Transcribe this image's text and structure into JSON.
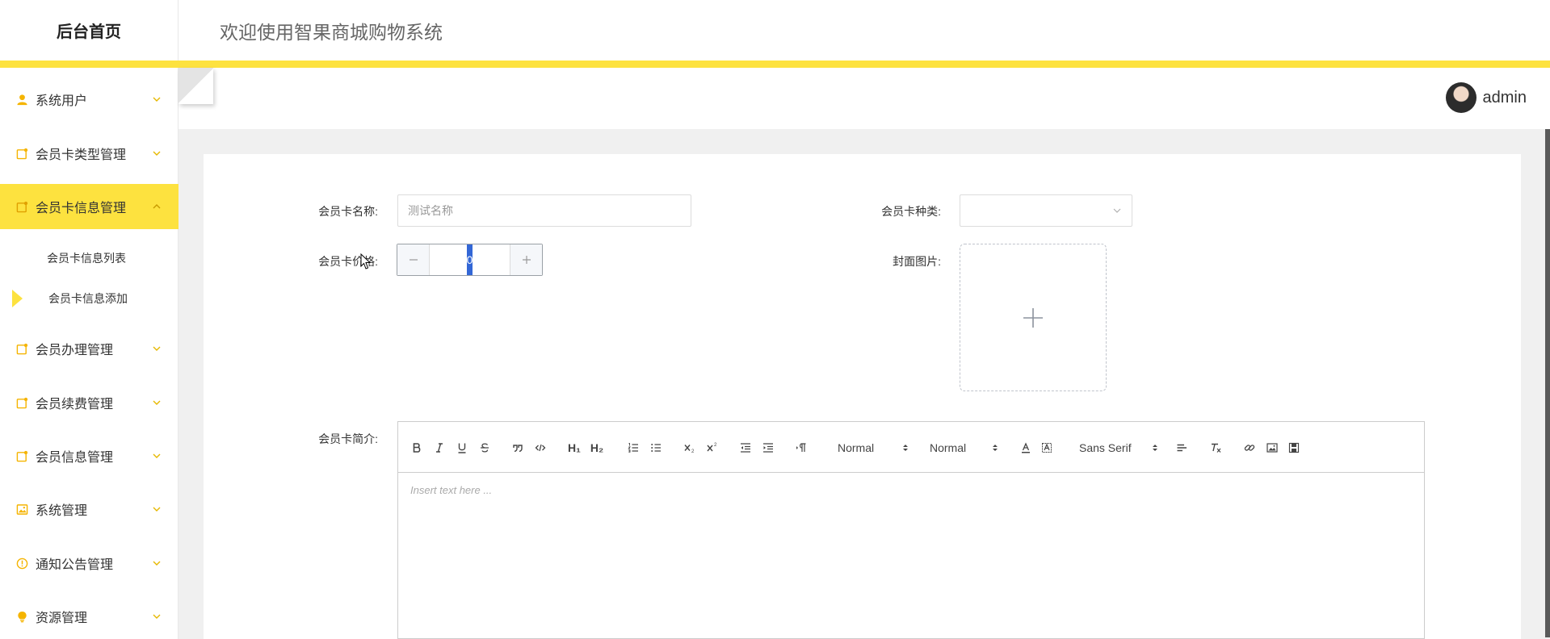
{
  "sidebar": {
    "logo": "后台首页",
    "items": [
      {
        "label": "系统用户",
        "icon": "user-icon",
        "expanded": false
      },
      {
        "label": "会员卡类型管理",
        "icon": "note-icon",
        "expanded": false
      },
      {
        "label": "会员卡信息管理",
        "icon": "note-icon",
        "expanded": true
      },
      {
        "label": "会员办理管理",
        "icon": "note-icon",
        "expanded": false
      },
      {
        "label": "会员续费管理",
        "icon": "note-icon",
        "expanded": false
      },
      {
        "label": "会员信息管理",
        "icon": "note-icon",
        "expanded": false
      },
      {
        "label": "系统管理",
        "icon": "image-icon",
        "expanded": false
      },
      {
        "label": "通知公告管理",
        "icon": "info-icon",
        "expanded": false
      },
      {
        "label": "资源管理",
        "icon": "bulb-icon",
        "expanded": false
      }
    ],
    "sub_items": [
      {
        "label": "会员卡信息列表",
        "active": false
      },
      {
        "label": "会员卡信息添加",
        "active": true
      }
    ]
  },
  "header": {
    "title": "欢迎使用智果商城购物系统",
    "user": "admin"
  },
  "form": {
    "name_label": "会员卡名称:",
    "name_placeholder": "测试名称",
    "type_label": "会员卡种类:",
    "type_value": "",
    "price_label": "会员卡价格:",
    "price_value": "0",
    "cover_label": "封面图片:",
    "intro_label": "会员卡简介:"
  },
  "editor": {
    "header_picker": "Normal",
    "size_picker": "Normal",
    "font_picker": "Sans Serif",
    "placeholder": "Insert text here ...",
    "h1": "H₁",
    "h2": "H₂"
  },
  "colors": {
    "accent": "#fde23f",
    "selection": "#3367d6"
  }
}
